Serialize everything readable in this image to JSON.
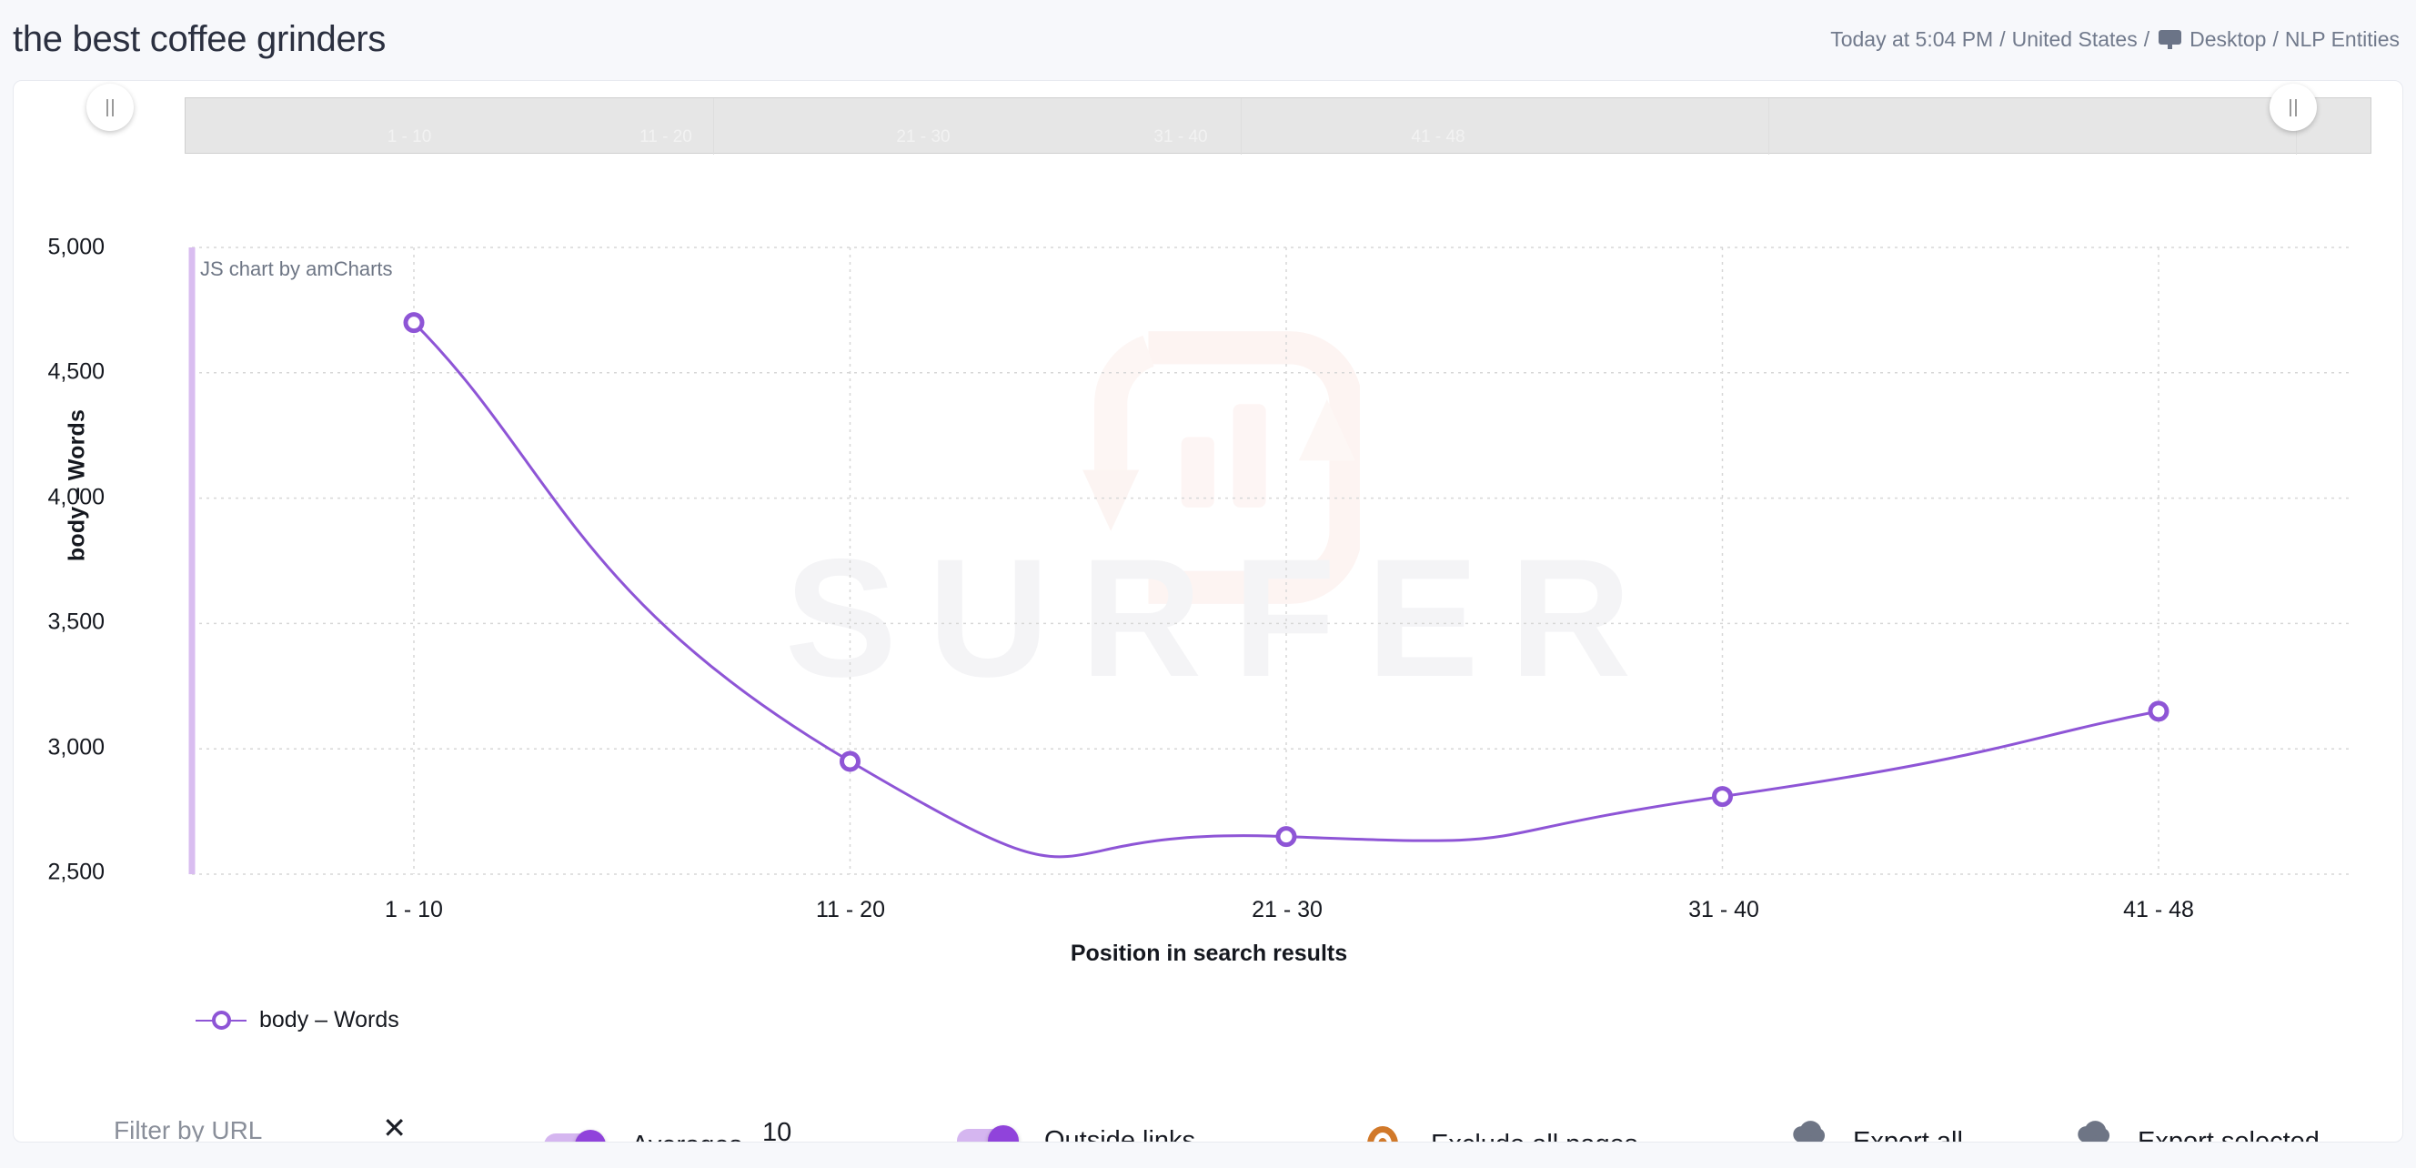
{
  "header": {
    "title": "the best coffee grinders",
    "time": "Today at 5:04 PM",
    "sep1": "/",
    "country": "United States",
    "sep2": "/",
    "device_icon": "monitor-icon",
    "device": "Desktop",
    "sep3": "/",
    "mode": "NLP Entities"
  },
  "range_selector": {
    "labels": [
      "1 - 10",
      "11 - 20",
      "21 - 30",
      "31 - 40",
      "41 - 48"
    ],
    "left_grip_icon": "grip-handle-icon",
    "right_grip_icon": "grip-handle-icon"
  },
  "chart_data": {
    "type": "line",
    "title": "",
    "credit": "JS chart by amCharts",
    "watermark": "SURFER",
    "categories": [
      "1 - 10",
      "11 - 20",
      "21 - 30",
      "31 - 40",
      "41 - 48"
    ],
    "series": [
      {
        "name": "body – Words",
        "values": [
          4700,
          2950,
          2650,
          2810,
          3150
        ],
        "color": "#8e55d6"
      }
    ],
    "xlabel": "Position in search results",
    "ylabel": "body – Words",
    "ylim": [
      2500,
      5000
    ],
    "yticks": [
      2500,
      3000,
      3500,
      4000,
      4500,
      5000
    ],
    "ytick_labels": [
      "2,500",
      "3,000",
      "3,500",
      "4,000",
      "4,500",
      "5,000"
    ],
    "grid": true,
    "legend_position": "bottom-left",
    "legend": [
      "body – Words"
    ]
  },
  "toolbar": {
    "filter_placeholder": "Filter by URL",
    "filter_value": "",
    "filter_clear_label": "✕",
    "averages_label": "Averages",
    "averages_value": "10",
    "averages_toggle_on": true,
    "outside_links_label": "Outside links",
    "outside_links_toggle_on": true,
    "exclude_label": "Exclude all pages",
    "exclude_icon": "eye-icon",
    "export_all_label": "Export all",
    "export_selected_label": "Export selected",
    "export_icon": "cloud-download-icon"
  },
  "colors": {
    "accent_purple": "#8e55d6",
    "toggle_purple": "#9043db",
    "toggle_track": "#d5b6f0",
    "eye_orange": "#d1792a",
    "page_bg": "#f7f8fb",
    "card_bg": "#ffffff"
  }
}
